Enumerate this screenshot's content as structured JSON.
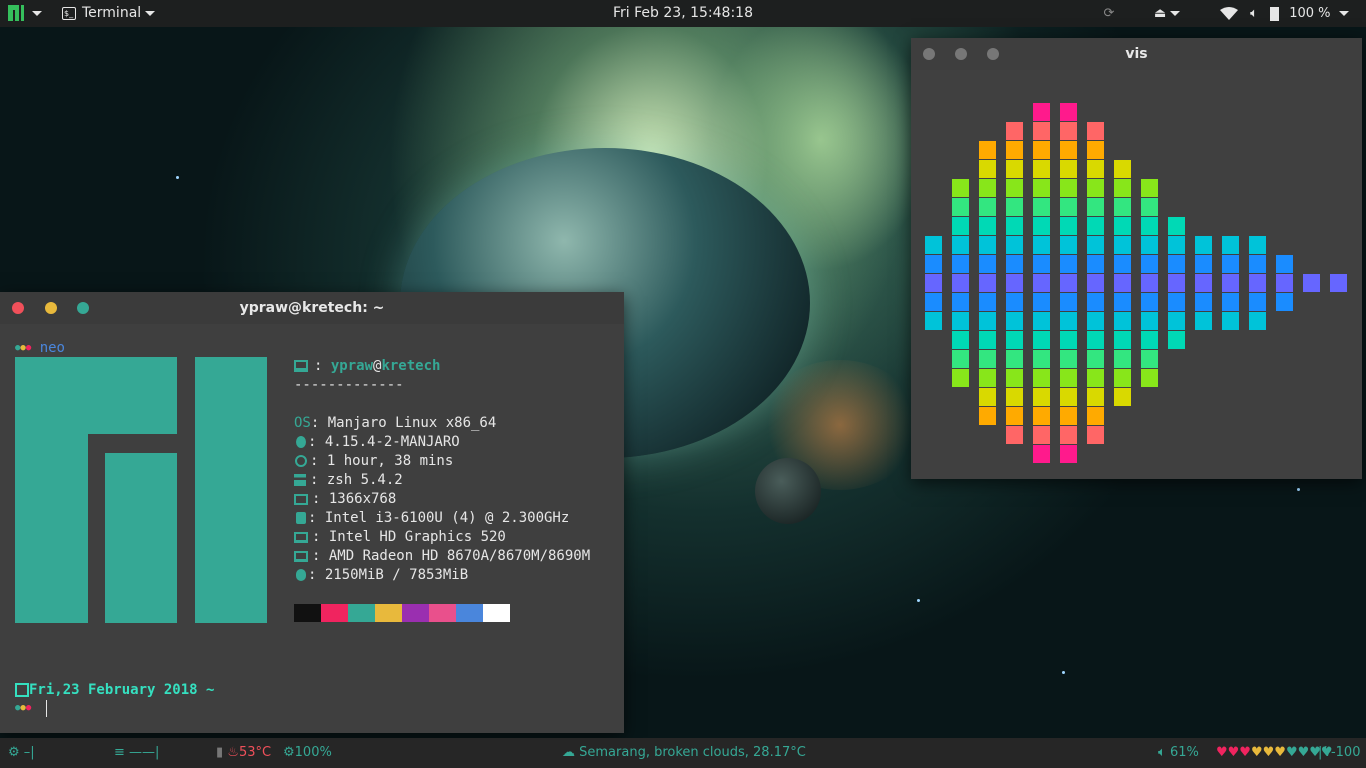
{
  "top_panel": {
    "app_menu": "Terminal",
    "clock": "Fri Feb 23, 15:48:18",
    "battery": "100 %"
  },
  "terminal": {
    "title": "ypraw@kretech: ~",
    "prompt_dir": "neo",
    "user": "ypraw",
    "at": "@",
    "host": "kretech",
    "separator": "-------------",
    "info": [
      {
        "key": "OS",
        "value": "Manjaro Linux x86_64"
      },
      {
        "key": "",
        "value": "4.15.4-2-MANJARO"
      },
      {
        "key": "",
        "value": "1 hour, 38 mins"
      },
      {
        "key": "",
        "value": "zsh 5.4.2"
      },
      {
        "key": "",
        "value": "1366x768"
      },
      {
        "key": "",
        "value": "Intel i3-6100U (4) @ 2.300GHz"
      },
      {
        "key": "",
        "value": "Intel HD Graphics 520"
      },
      {
        "key": "",
        "value": "AMD Radeon HD 8670A/8670M/8690M"
      },
      {
        "key": "",
        "value": "2150MiB / 7853MiB"
      }
    ],
    "date_line": "Fri,23 February 2018 ~",
    "palette": [
      "#111111",
      "#f0245f",
      "#35a895",
      "#e8b93c",
      "#9a2fb0",
      "#e9508c",
      "#4a86dc",
      "#ffffff"
    ]
  },
  "vis": {
    "title": "vis"
  },
  "bottom_panel": {
    "cpu_temp": "53°C",
    "cpu_load": "100%",
    "weather": "Semarang, broken clouds, 28.17°C",
    "volume": "61%",
    "brightness": "-100"
  }
}
